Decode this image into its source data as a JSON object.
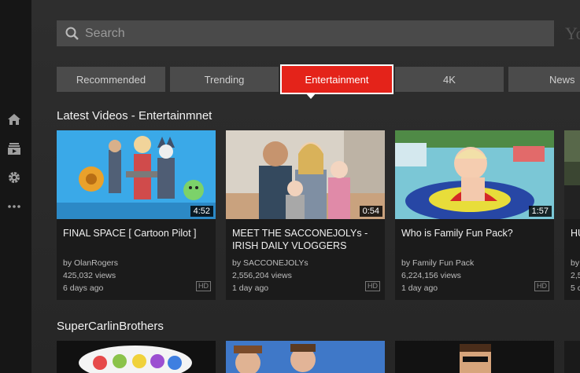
{
  "search": {
    "placeholder": "Search"
  },
  "brand": {
    "partial_logo": "Yo"
  },
  "nav_rail": {
    "icons": [
      "home-icon",
      "subscriptions-icon",
      "settings-icon",
      "more-icon"
    ]
  },
  "tabs": [
    {
      "label": "Recommended",
      "active": false
    },
    {
      "label": "Trending",
      "active": false
    },
    {
      "label": "Entertainment",
      "active": true
    },
    {
      "label": "4K",
      "active": false
    },
    {
      "label": "News",
      "active": false
    }
  ],
  "colors": {
    "accent": "#e4231a",
    "surface": "#4b4b4b",
    "card": "#1b1b1b"
  },
  "sections": [
    {
      "title": "Latest Videos - Entertainmnet",
      "videos": [
        {
          "title": "FINAL SPACE [ Cartoon Pilot ]",
          "channel": "by OlanRogers",
          "views": "425,032 views",
          "age": "6 days ago",
          "duration": "4:52",
          "badge": "HD"
        },
        {
          "title": "MEET THE SACCONEJOLYs - IRISH DAILY VLOGGERS",
          "channel": "by SACCONEJOLYs",
          "views": "2,556,204 views",
          "age": "1 day ago",
          "duration": "0:54",
          "badge": "HD"
        },
        {
          "title": "Who is Family Fun Pack?",
          "channel": "by Family Fun Pack",
          "views": "6,224,156 views",
          "age": "1 day ago",
          "duration": "1:57",
          "badge": "HD"
        },
        {
          "title": "HU",
          "channel": "by",
          "views": "2,5",
          "age": "5 c",
          "duration": "",
          "badge": ""
        }
      ]
    },
    {
      "title": "SuperCarlinBrothers"
    }
  ]
}
